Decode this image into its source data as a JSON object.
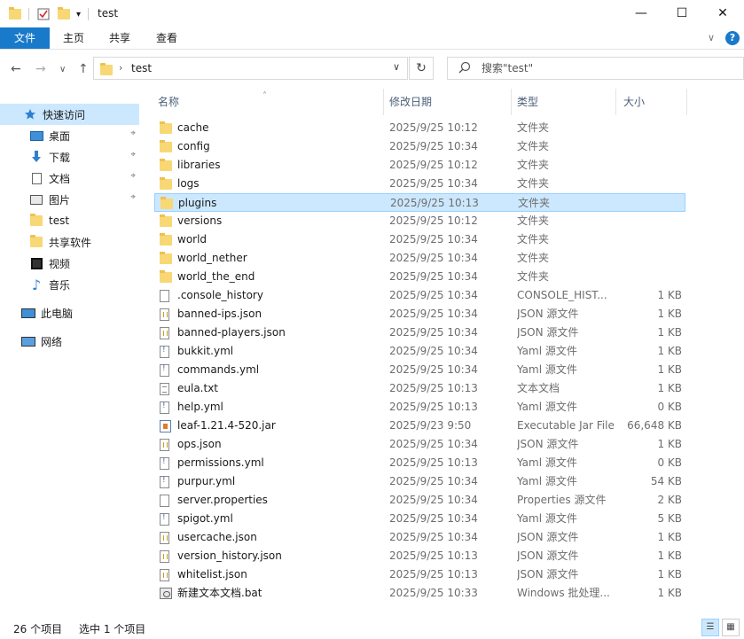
{
  "window": {
    "title": "test",
    "minimize": "—",
    "maximize": "☐",
    "close": "✕"
  },
  "quick_access_toolbar": {
    "dropdown": "▾"
  },
  "ribbon": {
    "tabs": [
      "文件",
      "主页",
      "共享",
      "查看"
    ],
    "help": "?",
    "collapse": "∨"
  },
  "navigation": {
    "back": "←",
    "forward": "→",
    "recent": "∨",
    "up": "↑",
    "breadcrumb": "test",
    "breadcrumb_sep": "›",
    "address_dropdown": "∨",
    "refresh": "↻"
  },
  "search": {
    "placeholder": "搜索\"test\""
  },
  "sidebar": {
    "items": [
      {
        "label": "快速访问",
        "icon": "star-icon"
      },
      {
        "label": "桌面",
        "icon": "desktop-icon",
        "pinned": true
      },
      {
        "label": "下载",
        "icon": "download-icon",
        "pinned": true
      },
      {
        "label": "文档",
        "icon": "document-icon",
        "pinned": true
      },
      {
        "label": "图片",
        "icon": "pictures-icon",
        "pinned": true
      },
      {
        "label": "test",
        "icon": "folder-icon"
      },
      {
        "label": "共享软件",
        "icon": "folder-icon"
      },
      {
        "label": "视频",
        "icon": "video-icon"
      },
      {
        "label": "音乐",
        "icon": "music-icon"
      },
      {
        "label": "此电脑",
        "icon": "computer-icon"
      },
      {
        "label": "网络",
        "icon": "network-icon"
      }
    ],
    "pin_glyph": "⌖"
  },
  "columns": {
    "name": "名称",
    "date": "修改日期",
    "type": "类型",
    "size": "大小",
    "sort_caret": "˄"
  },
  "files": [
    {
      "name": "cache",
      "date": "2025/9/25 10:12",
      "type": "文件夹",
      "size": "",
      "icon": "folder"
    },
    {
      "name": "config",
      "date": "2025/9/25 10:34",
      "type": "文件夹",
      "size": "",
      "icon": "folder"
    },
    {
      "name": "libraries",
      "date": "2025/9/25 10:12",
      "type": "文件夹",
      "size": "",
      "icon": "folder"
    },
    {
      "name": "logs",
      "date": "2025/9/25 10:34",
      "type": "文件夹",
      "size": "",
      "icon": "folder"
    },
    {
      "name": "plugins",
      "date": "2025/9/25 10:13",
      "type": "文件夹",
      "size": "",
      "icon": "folder",
      "selected": true
    },
    {
      "name": "versions",
      "date": "2025/9/25 10:12",
      "type": "文件夹",
      "size": "",
      "icon": "folder"
    },
    {
      "name": "world",
      "date": "2025/9/25 10:34",
      "type": "文件夹",
      "size": "",
      "icon": "folder"
    },
    {
      "name": "world_nether",
      "date": "2025/9/25 10:34",
      "type": "文件夹",
      "size": "",
      "icon": "folder"
    },
    {
      "name": "world_the_end",
      "date": "2025/9/25 10:34",
      "type": "文件夹",
      "size": "",
      "icon": "folder"
    },
    {
      "name": ".console_history",
      "date": "2025/9/25 10:34",
      "type": "CONSOLE_HIST...",
      "size": "1 KB",
      "icon": "file"
    },
    {
      "name": "banned-ips.json",
      "date": "2025/9/25 10:34",
      "type": "JSON 源文件",
      "size": "1 KB",
      "icon": "json"
    },
    {
      "name": "banned-players.json",
      "date": "2025/9/25 10:34",
      "type": "JSON 源文件",
      "size": "1 KB",
      "icon": "json"
    },
    {
      "name": "bukkit.yml",
      "date": "2025/9/25 10:34",
      "type": "Yaml 源文件",
      "size": "1 KB",
      "icon": "yaml"
    },
    {
      "name": "commands.yml",
      "date": "2025/9/25 10:34",
      "type": "Yaml 源文件",
      "size": "1 KB",
      "icon": "yaml"
    },
    {
      "name": "eula.txt",
      "date": "2025/9/25 10:13",
      "type": "文本文档",
      "size": "1 KB",
      "icon": "txt"
    },
    {
      "name": "help.yml",
      "date": "2025/9/25 10:13",
      "type": "Yaml 源文件",
      "size": "0 KB",
      "icon": "yaml"
    },
    {
      "name": "leaf-1.21.4-520.jar",
      "date": "2025/9/23 9:50",
      "type": "Executable Jar File",
      "size": "66,648 KB",
      "icon": "jar"
    },
    {
      "name": "ops.json",
      "date": "2025/9/25 10:34",
      "type": "JSON 源文件",
      "size": "1 KB",
      "icon": "json"
    },
    {
      "name": "permissions.yml",
      "date": "2025/9/25 10:13",
      "type": "Yaml 源文件",
      "size": "0 KB",
      "icon": "yaml"
    },
    {
      "name": "purpur.yml",
      "date": "2025/9/25 10:34",
      "type": "Yaml 源文件",
      "size": "54 KB",
      "icon": "yaml"
    },
    {
      "name": "server.properties",
      "date": "2025/9/25 10:34",
      "type": "Properties 源文件",
      "size": "2 KB",
      "icon": "file"
    },
    {
      "name": "spigot.yml",
      "date": "2025/9/25 10:34",
      "type": "Yaml 源文件",
      "size": "5 KB",
      "icon": "yaml"
    },
    {
      "name": "usercache.json",
      "date": "2025/9/25 10:34",
      "type": "JSON 源文件",
      "size": "1 KB",
      "icon": "json"
    },
    {
      "name": "version_history.json",
      "date": "2025/9/25 10:13",
      "type": "JSON 源文件",
      "size": "1 KB",
      "icon": "json"
    },
    {
      "name": "whitelist.json",
      "date": "2025/9/25 10:13",
      "type": "JSON 源文件",
      "size": "1 KB",
      "icon": "json"
    },
    {
      "name": "新建文本文档.bat",
      "date": "2025/9/25 10:33",
      "type": "Windows 批处理...",
      "size": "1 KB",
      "icon": "bat"
    }
  ],
  "status": {
    "item_count": "26 个项目",
    "selection": "选中 1 个项目",
    "details_view": "☰",
    "icons_view": "▦"
  },
  "colors": {
    "accent": "#1979ca",
    "selection_bg": "#cce8ff",
    "selection_border": "#99d1ff",
    "folder": "#f8d775"
  }
}
